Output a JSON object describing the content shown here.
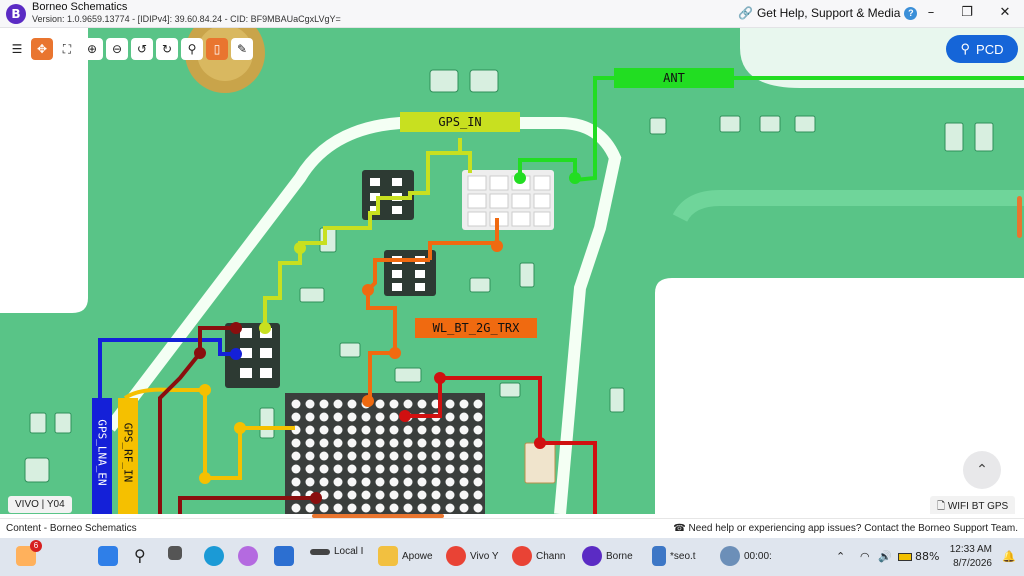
{
  "app": {
    "title": "Borneo Schematics",
    "version_line": "Version: 1.0.9659.13774 - [IDIPv4]: 39.60.84.24 - CID: BF9MBAUaCgxLVgY=",
    "help_link": "Get Help, Support & Media"
  },
  "toolbar": [
    "list-icon",
    "fit-icon",
    "fullscreen-icon",
    "zoom-in-icon",
    "zoom-out-icon",
    "rotate-left-icon",
    "rotate-right-icon",
    "search-icon",
    "mouse-icon",
    "pen-icon"
  ],
  "pcd_button": "PCD",
  "nets": {
    "ant": "ANT",
    "gps_in": "GPS_IN",
    "wl_bt": "WL_BT_2G_TRX",
    "gps_lna_en": "GPS_LNA_EN",
    "gps_rf_in": "GPS_RF_IN"
  },
  "colors": {
    "ant": "#22dd22",
    "gps_in": "#c8e020",
    "wl_bt": "#f06a10",
    "gps_lna_en": "#1420d8",
    "gps_rf_in": "#f5c000",
    "red_net": "#d01010",
    "dark_red_net": "#8a0e0e",
    "accent": "#e9752f"
  },
  "chips": {
    "model": "VIVO | Y04",
    "category": "WIFI BT GPS"
  },
  "status": {
    "left": "Content - Borneo Schematics",
    "right": "Need help or experiencing app issues? Contact the Borneo Support Team."
  },
  "taskbar": {
    "apps": [
      "Local I",
      "Apowe",
      "Vivo Y",
      "Chann",
      "Borne",
      "*seo.t",
      "00:00:"
    ],
    "badge": "6",
    "battery": "88%",
    "time": "12:33 AM",
    "date": "8/7/2026"
  }
}
